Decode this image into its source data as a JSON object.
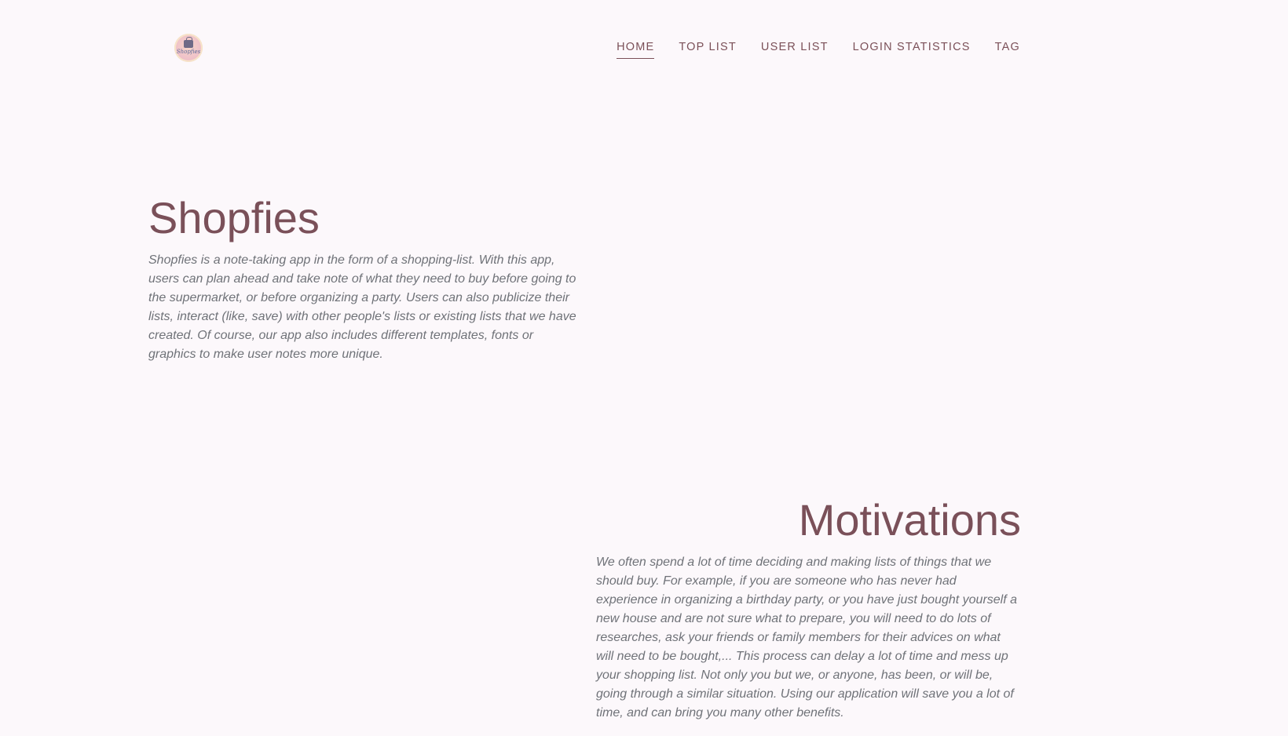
{
  "header": {
    "logo_text": "Shopfies",
    "nav": [
      {
        "label": "HOME",
        "active": true
      },
      {
        "label": "TOP LIST",
        "active": false
      },
      {
        "label": "USER LIST",
        "active": false
      },
      {
        "label": "LOGIN STATISTICS",
        "active": false
      },
      {
        "label": "TAG",
        "active": false
      }
    ]
  },
  "hero": {
    "title": "Shopfies",
    "description": "Shopfies is a note-taking app in the form of a shopping-list. With this app, users can plan ahead and take note of what they need to buy before going to the supermarket, or before organizing a party. Users can also publicize their lists, interact (like, save) with other people's lists or existing lists that we have created. Of course, our app also includes different templates, fonts or graphics to make user notes more unique."
  },
  "motivations": {
    "title": "Motivations",
    "description": "We often spend a lot of time deciding and making lists of things that we should buy. For example, if you are someone who has never had experience in organizing a birthday party, or you have just bought yourself a new house and are not sure what to prepare, you will need to do lots of researches, ask your friends or family members for their advices on what will need to be bought,... This process can delay a lot of time and mess up your shopping list. Not only you but we, or anyone, has been, or will be, going through a similar situation. Using our application will save you a lot of time, and can bring you many other benefits."
  },
  "colors": {
    "background": "#fcf8fb",
    "accent": "#7a5059",
    "body_text": "#6f7278"
  }
}
